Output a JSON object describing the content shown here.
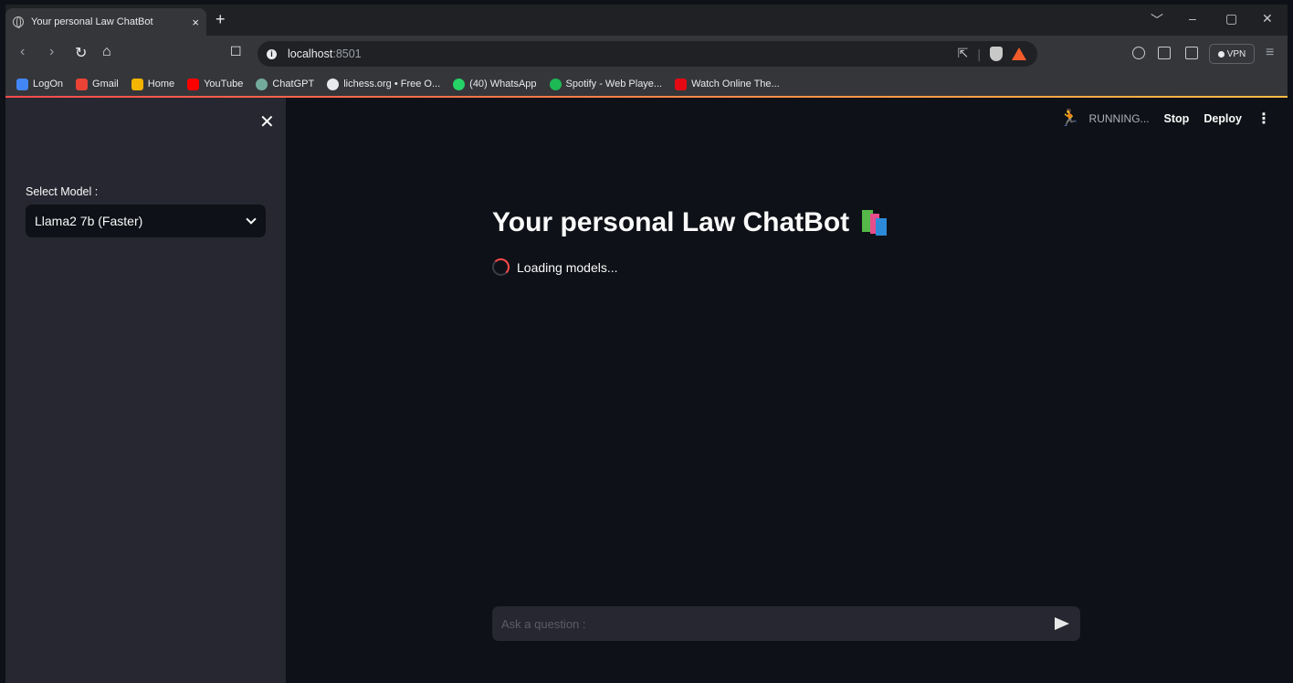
{
  "browser": {
    "tab_title": "Your personal Law ChatBot",
    "tab_close": "×",
    "new_tab": "+",
    "url_host": "localhost",
    "url_port": ":8501",
    "vpn_label": "VPN",
    "window_controls": [
      "﹀",
      "–",
      "▢",
      "✕"
    ]
  },
  "bookmarks": [
    {
      "label": "LogOn",
      "color": "#4285f4"
    },
    {
      "label": "Gmail",
      "color": "#ea4335"
    },
    {
      "label": "Home",
      "color": "#f4b400"
    },
    {
      "label": "YouTube",
      "color": "#ff0000"
    },
    {
      "label": "ChatGPT",
      "color": "#74aa9c"
    },
    {
      "label": "lichess.org • Free O...",
      "color": "#e8eaed"
    },
    {
      "label": "(40) WhatsApp",
      "color": "#25d366"
    },
    {
      "label": "Spotify - Web Playe...",
      "color": "#1db954"
    },
    {
      "label": "Watch Online The...",
      "color": "#e50914"
    }
  ],
  "sidebar": {
    "close": "✕",
    "select_label": "Select Model :",
    "select_value": "Llama2 7b (Faster)"
  },
  "header": {
    "running": "RUNNING...",
    "stop": "Stop",
    "deploy": "Deploy",
    "menu": "⋮"
  },
  "main": {
    "title": "Your personal Law ChatBot",
    "loading": "Loading models...",
    "input_placeholder": "Ask a question :"
  },
  "colors": {
    "accent": "#ff4b4b",
    "background": "#0e1117",
    "sidebar": "#262730"
  }
}
